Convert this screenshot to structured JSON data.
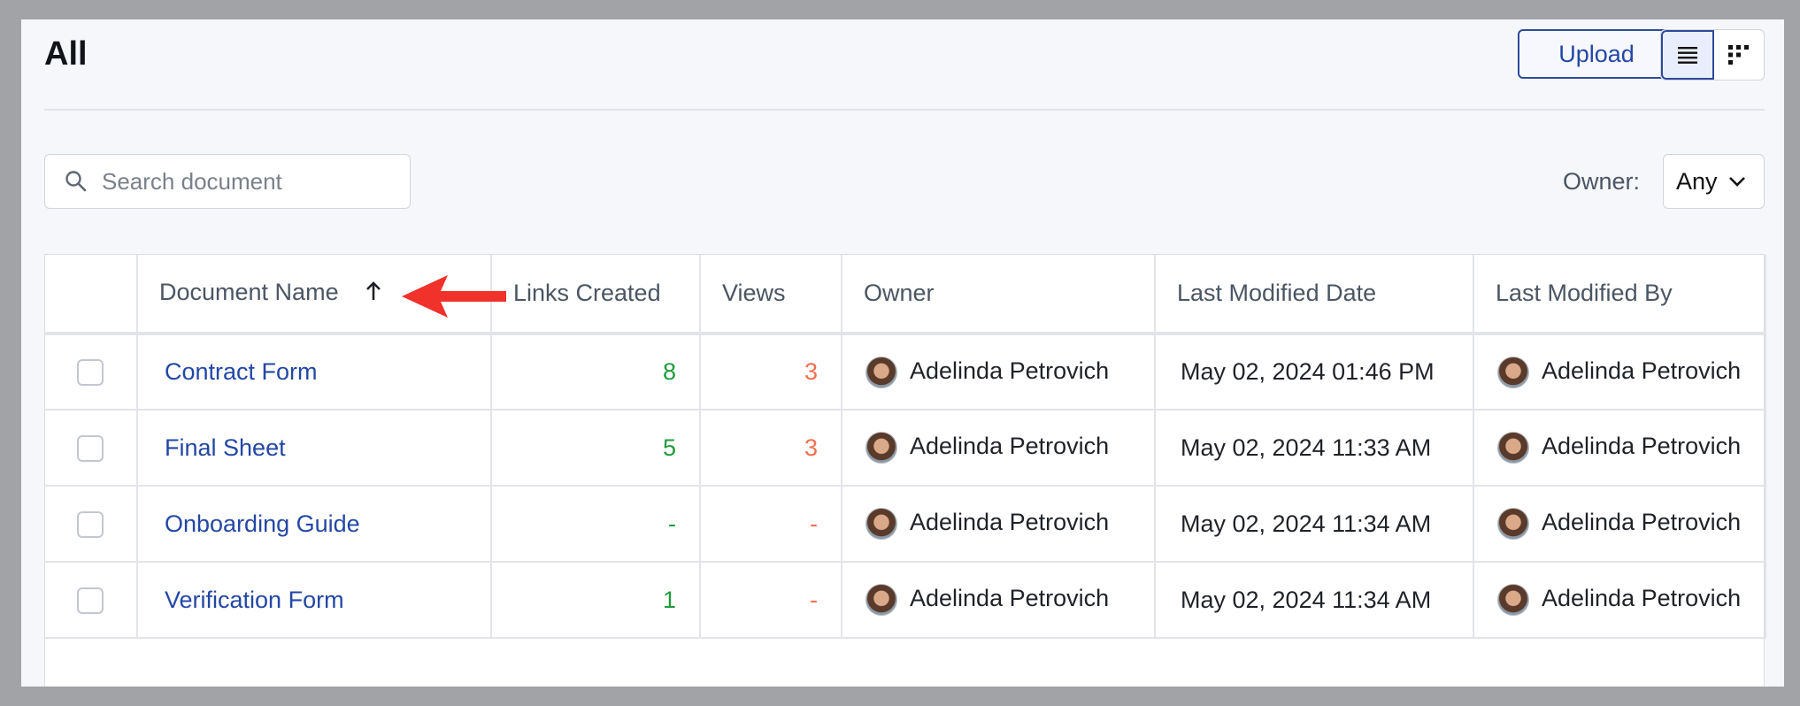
{
  "header": {
    "title": "All",
    "upload_label": "Upload"
  },
  "view_toggle": {
    "list_icon": "list-view-icon",
    "grid_icon": "grid-view-icon",
    "active": "list"
  },
  "search": {
    "placeholder": "Search document",
    "value": ""
  },
  "owner_filter": {
    "label": "Owner:",
    "value": "Any"
  },
  "table": {
    "columns": [
      "Document Name",
      "Links Created",
      "Views",
      "Owner",
      "Last Modified Date",
      "Last Modified By"
    ],
    "sort": {
      "column": "Document Name",
      "direction": "ascending"
    },
    "rows": [
      {
        "name": "Contract Form",
        "links": "8",
        "views": "3",
        "owner": "Adelinda Petrovich",
        "modified": "May 02, 2024 01:46 PM",
        "modified_by": "Adelinda Petrovich"
      },
      {
        "name": "Final Sheet",
        "links": "5",
        "views": "3",
        "owner": "Adelinda Petrovich",
        "modified": "May 02, 2024 11:33 AM",
        "modified_by": "Adelinda Petrovich"
      },
      {
        "name": "Onboarding Guide",
        "links": "-",
        "views": "-",
        "owner": "Adelinda Petrovich",
        "modified": "May 02, 2024 11:34 AM",
        "modified_by": "Adelinda Petrovich"
      },
      {
        "name": "Verification Form",
        "links": "1",
        "views": "-",
        "owner": "Adelinda Petrovich",
        "modified": "May 02, 2024 11:34 AM",
        "modified_by": "Adelinda Petrovich"
      }
    ]
  },
  "colors": {
    "accent": "#2347a4",
    "links": "#1e9b3b",
    "views": "#f0714f",
    "annotation": "#f0322a"
  }
}
